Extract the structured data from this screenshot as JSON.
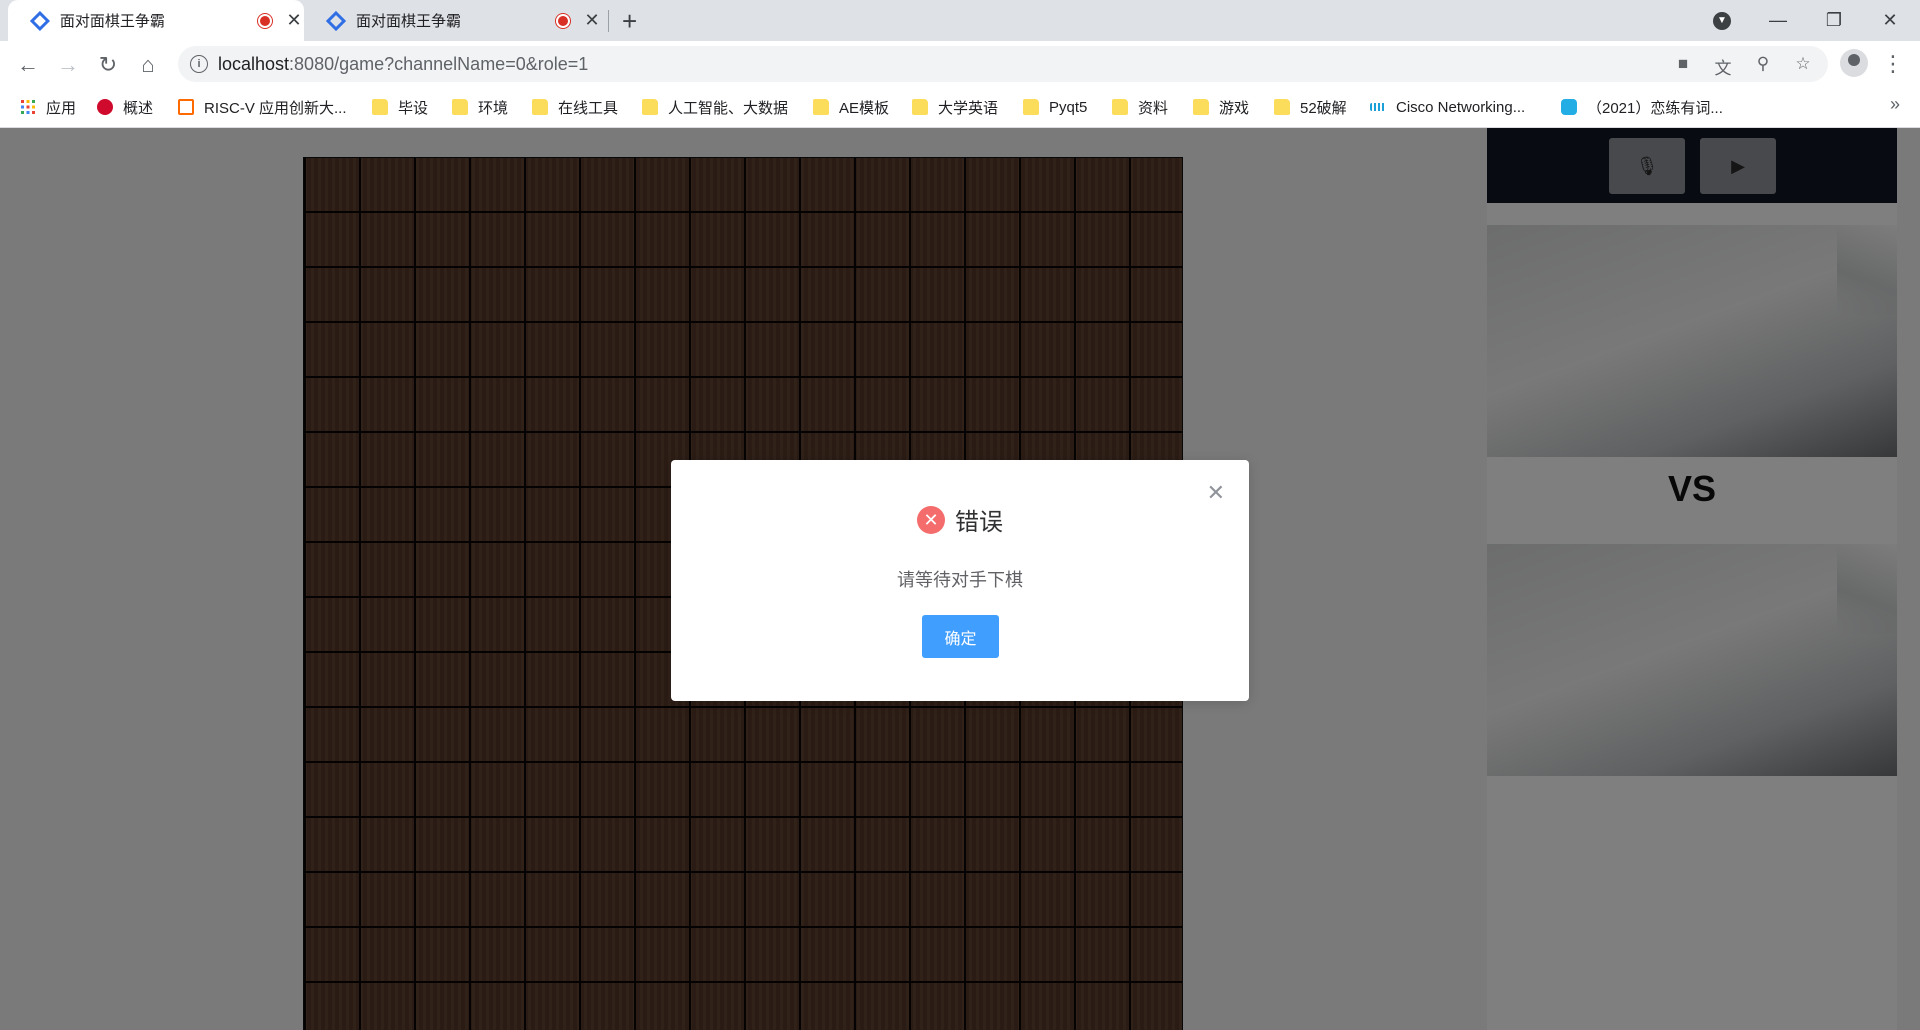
{
  "tabs": [
    {
      "title": "面对面棋王争霸"
    },
    {
      "title": "面对面棋王争霸"
    }
  ],
  "toolbar": {
    "url_host": "localhost",
    "url_rest": ":8080/game?channelName=0&role=1"
  },
  "bookmarks": [
    {
      "label": "应用",
      "icon": "apps-grid-icon"
    },
    {
      "label": "概述",
      "icon": "huawei-icon"
    },
    {
      "label": "RISC-V 应用创新大...",
      "icon": "risc-v-icon"
    },
    {
      "label": "毕设",
      "icon": "folder-icon"
    },
    {
      "label": "环境",
      "icon": "folder-icon"
    },
    {
      "label": "在线工具",
      "icon": "folder-icon"
    },
    {
      "label": "人工智能、大数据",
      "icon": "folder-icon"
    },
    {
      "label": "AE模板",
      "icon": "folder-icon"
    },
    {
      "label": "大学英语",
      "icon": "folder-icon"
    },
    {
      "label": "Pyqt5",
      "icon": "folder-icon"
    },
    {
      "label": "资料",
      "icon": "folder-icon"
    },
    {
      "label": "游戏",
      "icon": "folder-icon"
    },
    {
      "label": "52破解",
      "icon": "folder-icon"
    },
    {
      "label": "Cisco Networking...",
      "icon": "cisco-icon"
    },
    {
      "label": "（2021）恋练有词...",
      "icon": "bilibili-icon"
    }
  ],
  "game": {
    "vs_label": "VS"
  },
  "dialog": {
    "title": "错误",
    "message": "请等待对手下棋",
    "ok_label": "确定"
  },
  "colors": {
    "accent": "#409eff",
    "error": "#f56c6c",
    "board": "#5a3b2a"
  }
}
